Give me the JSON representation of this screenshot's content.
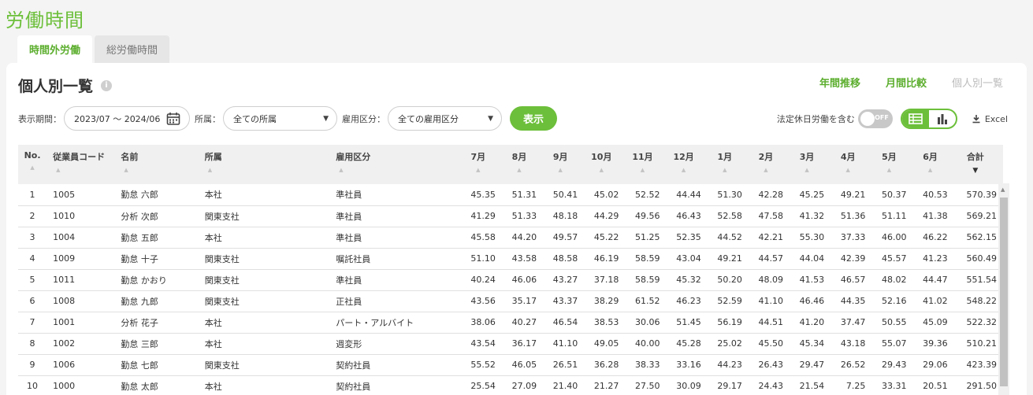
{
  "page_title": "労働時間",
  "tabs": [
    {
      "label": "時間外労働",
      "active": true
    },
    {
      "label": "総労働時間",
      "active": false
    }
  ],
  "card": {
    "title": "個人別一覧",
    "info_icon": "info-icon",
    "view_links": [
      "年間推移",
      "月間比較",
      "個人別一覧"
    ]
  },
  "filters": {
    "period_label": "表示期間：",
    "period_value": "2023/07 ～ 2024/06",
    "dept_label": "所属：",
    "dept_value": "全ての所属",
    "emp_type_label": "雇用区分：",
    "emp_type_value": "全ての雇用区分",
    "show_button": "表示"
  },
  "tools": {
    "holiday_label": "法定休日労働を含む",
    "toggle_text": "OFF",
    "excel_label": "Excel"
  },
  "table": {
    "headers": [
      "No.",
      "従業員コード",
      "名前",
      "所属",
      "雇用区分",
      "7月",
      "8月",
      "9月",
      "10月",
      "11月",
      "12月",
      "1月",
      "2月",
      "3月",
      "4月",
      "5月",
      "6月",
      "合計"
    ],
    "rows": [
      [
        "1",
        "1005",
        "勤怠 六郎",
        "本社",
        "準社員",
        "45.35",
        "51.31",
        "50.41",
        "45.02",
        "52.52",
        "44.44",
        "51.30",
        "42.28",
        "45.25",
        "49.21",
        "50.37",
        "40.53",
        "570.39"
      ],
      [
        "2",
        "1010",
        "分析 次郎",
        "関東支社",
        "準社員",
        "41.29",
        "51.33",
        "48.18",
        "44.29",
        "49.56",
        "46.43",
        "52.58",
        "47.58",
        "41.32",
        "51.36",
        "51.11",
        "41.38",
        "569.21"
      ],
      [
        "3",
        "1004",
        "勤怠 五郎",
        "本社",
        "準社員",
        "45.58",
        "44.20",
        "49.57",
        "45.22",
        "51.25",
        "52.35",
        "44.52",
        "42.21",
        "55.30",
        "37.33",
        "46.00",
        "46.22",
        "562.15"
      ],
      [
        "4",
        "1009",
        "勤怠 十子",
        "関東支社",
        "嘱託社員",
        "51.10",
        "43.58",
        "48.58",
        "46.19",
        "58.59",
        "43.04",
        "49.21",
        "44.57",
        "44.04",
        "42.39",
        "45.57",
        "41.23",
        "560.49"
      ],
      [
        "5",
        "1011",
        "勤怠 かおり",
        "関東支社",
        "準社員",
        "40.24",
        "46.06",
        "43.27",
        "37.18",
        "58.59",
        "45.32",
        "50.20",
        "48.09",
        "41.53",
        "46.57",
        "48.02",
        "44.47",
        "551.54"
      ],
      [
        "6",
        "1008",
        "勤怠 九郎",
        "関東支社",
        "正社員",
        "43.56",
        "35.17",
        "43.37",
        "38.29",
        "61.52",
        "46.23",
        "52.59",
        "41.10",
        "46.46",
        "44.35",
        "52.16",
        "41.02",
        "548.22"
      ],
      [
        "7",
        "1001",
        "分析 花子",
        "本社",
        "パート・アルバイト",
        "38.06",
        "40.27",
        "46.54",
        "38.53",
        "30.06",
        "51.45",
        "56.19",
        "44.51",
        "41.20",
        "37.47",
        "50.55",
        "45.09",
        "522.32"
      ],
      [
        "8",
        "1002",
        "勤怠 三郎",
        "本社",
        "週変形",
        "43.54",
        "36.17",
        "41.10",
        "49.05",
        "40.00",
        "45.28",
        "25.02",
        "45.50",
        "45.34",
        "43.18",
        "55.07",
        "39.36",
        "510.21"
      ],
      [
        "9",
        "1006",
        "勤怠 七郎",
        "関東支社",
        "契約社員",
        "55.52",
        "46.05",
        "26.51",
        "36.28",
        "38.33",
        "33.16",
        "44.23",
        "26.43",
        "29.47",
        "26.52",
        "29.43",
        "29.06",
        "423.39"
      ],
      [
        "10",
        "1000",
        "勤怠 太郎",
        "本社",
        "契約社員",
        "25.54",
        "27.09",
        "21.40",
        "21.27",
        "27.50",
        "30.09",
        "29.17",
        "24.43",
        "21.54",
        "7.25",
        "33.31",
        "20.51",
        "291.50"
      ]
    ]
  }
}
